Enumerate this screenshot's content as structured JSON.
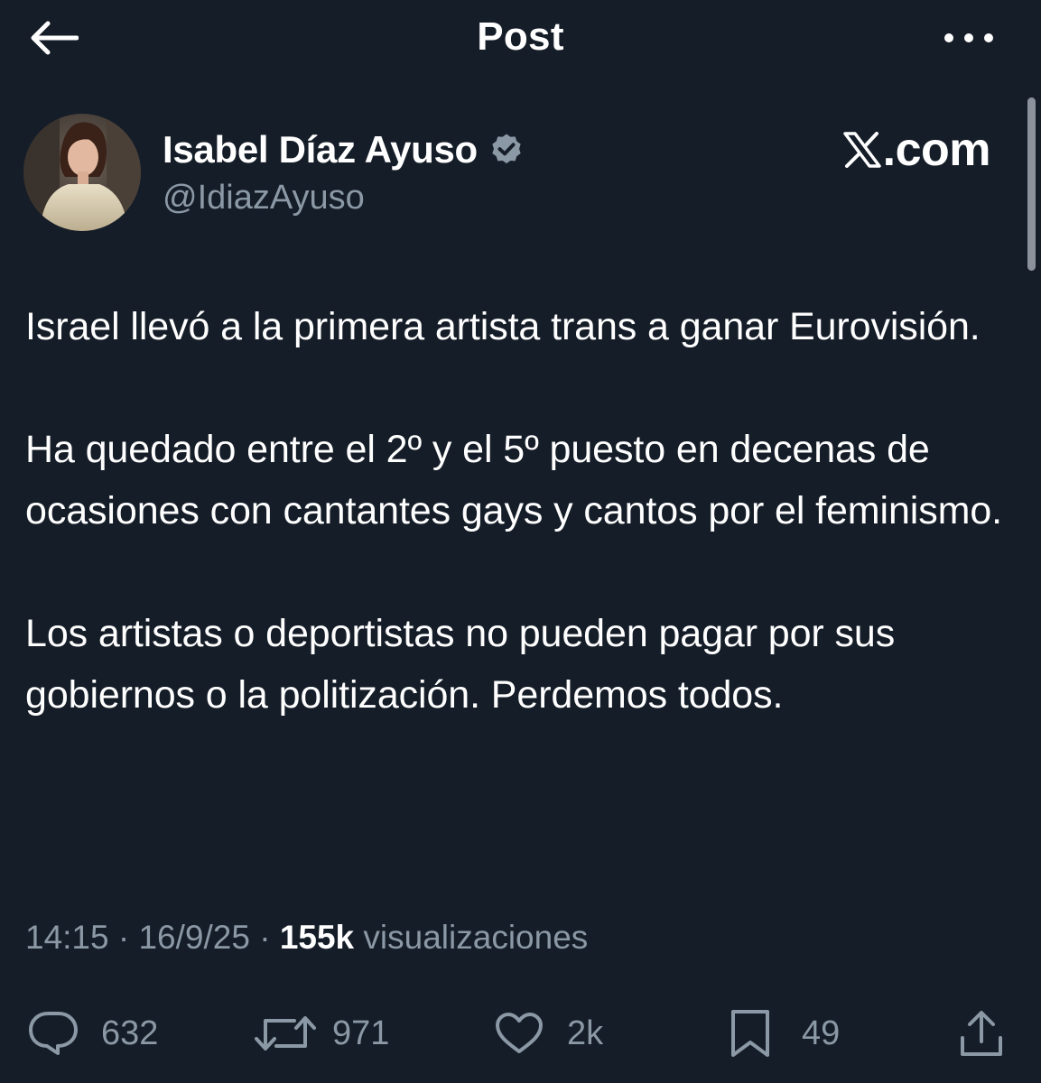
{
  "header": {
    "title": "Post",
    "back_icon": "arrow-left-icon",
    "more_icon": "more-horizontal-icon"
  },
  "author": {
    "name": "Isabel Díaz Ayuso",
    "handle": "@IdiazAyuso",
    "verified": true,
    "verified_badge_color": "#8b98a5"
  },
  "brand": {
    "text": ".com"
  },
  "tweet": {
    "paragraphs": [
      "Israel llevó a la primera artista trans a ganar Eurovisión.",
      "Ha quedado entre el 2º y el 5º puesto en decenas de ocasiones con cantantes gays y cantos por el feminismo.",
      "Los artistas o deportistas no pueden pagar por sus gobiernos o la politización. Perdemos todos."
    ]
  },
  "meta": {
    "time": "14:15",
    "date": "16/9/25",
    "views_count": "155k",
    "views_label": "visualizaciones"
  },
  "actions": {
    "replies": "632",
    "reposts": "971",
    "likes": "2k",
    "bookmarks": "49"
  },
  "colors": {
    "background": "#151d28",
    "text_primary": "#ffffff",
    "text_secondary": "#8b98a5"
  }
}
